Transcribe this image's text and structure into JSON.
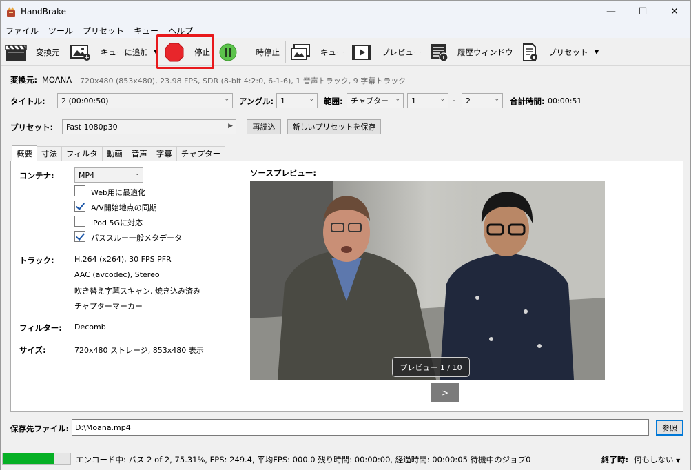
{
  "window": {
    "title": "HandBrake",
    "minimize": "—",
    "maximize": "☐",
    "close": "✕"
  },
  "menu": [
    "ファイル",
    "ツール",
    "プリセット",
    "キュー",
    "ヘルプ"
  ],
  "toolbar": {
    "source": "変換元",
    "add_queue": "キューに追加",
    "stop": "停止",
    "pause": "一時停止",
    "queue": "キュー",
    "preview": "プレビュー",
    "activity": "履歴ウィンドウ",
    "presets": "プリセット"
  },
  "source": {
    "label": "変換元:",
    "name": "MOANA",
    "info": "720x480 (853x480), 23.98 FPS, SDR (8-bit 4:2:0, 6-1-6), 1 音声トラック, 9 字幕トラック"
  },
  "title_row": {
    "title_label": "タイトル:",
    "title_value": "2  (00:00:50)",
    "angle_label": "アングル:",
    "angle_value": "1",
    "range_label": "範囲:",
    "range_type": "チャプター",
    "range_start": "1",
    "dash": "-",
    "range_end": "2",
    "duration_label": "合計時間:",
    "duration_value": "00:00:51"
  },
  "preset_row": {
    "label": "プリセット:",
    "value": "Fast 1080p30",
    "reload": "再読込",
    "save_new": "新しいプリセットを保存"
  },
  "tabs": [
    "概要",
    "寸法",
    "フィルタ",
    "動画",
    "音声",
    "字幕",
    "チャプター"
  ],
  "summary": {
    "container_label": "コンテナ:",
    "container_value": "MP4",
    "options": [
      {
        "label": "Web用に最適化",
        "checked": false
      },
      {
        "label": "A/V開始地点の同期",
        "checked": true
      },
      {
        "label": "iPod 5Gに対応",
        "checked": false
      },
      {
        "label": "パススルー一般メタデータ",
        "checked": true
      }
    ],
    "tracks_label": "トラック:",
    "tracks": [
      "H.264 (x264), 30 FPS PFR",
      "AAC (avcodec), Stereo",
      "吹き替え字幕スキャン, 焼き込み済み",
      "チャプターマーカー"
    ],
    "filters_label": "フィルター:",
    "filters_value": "Decomb",
    "size_label": "サイズ:",
    "size_value": "720x480 ストレージ, 853x480 表示",
    "preview_label": "ソースプレビュー:",
    "preview_badge": "プレビュー 1 / 10",
    "next": ">"
  },
  "destination": {
    "label": "保存先ファイル:",
    "value": "D:\\Moana.mp4",
    "browse": "参照"
  },
  "status": {
    "progress": 0.7531,
    "text": "エンコード中: パス 2 of 2,  75.31%, FPS: 249.4,  平均FPS: 000.0 残り時間: 00:00:00,  経過時間: 00:00:05    待機中のジョブ0",
    "when_done_label": "終了時:",
    "when_done_value": "何もしない"
  },
  "colors": {
    "highlight": "#e8191c",
    "progress": "#06b025",
    "stop": "#e8262b",
    "pause": "#5cc34c"
  }
}
